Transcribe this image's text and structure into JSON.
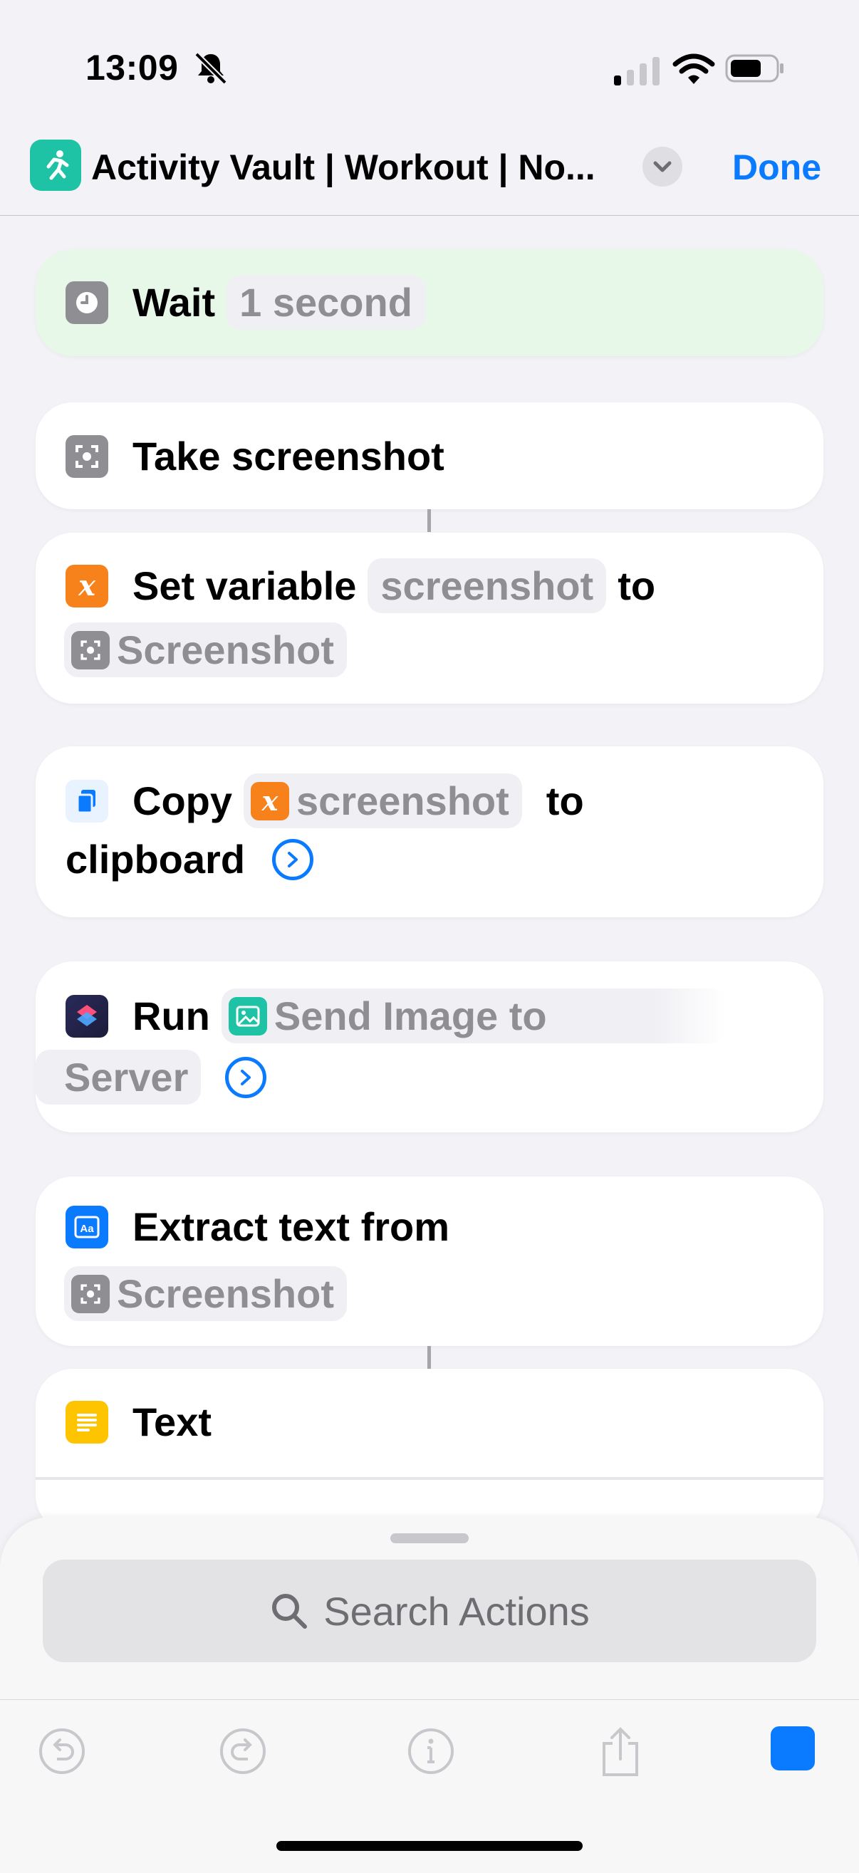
{
  "status_bar": {
    "time": "13:09"
  },
  "nav": {
    "title": "Activity Vault | Workout | No...",
    "done_label": "Done"
  },
  "actions": {
    "wait": {
      "verb": "Wait",
      "value": "1 second"
    },
    "take_screenshot": {
      "label": "Take screenshot"
    },
    "set_variable": {
      "verb": "Set variable",
      "variable": "screenshot",
      "to": "to",
      "value": "Screenshot"
    },
    "copy": {
      "verb": "Copy",
      "variable": "screenshot",
      "to": "to",
      "rest": "clipboard"
    },
    "run": {
      "verb": "Run",
      "shortcut_part1": "Send Image to",
      "shortcut_part2": "Server"
    },
    "extract": {
      "verb": "Extract text from",
      "value": "Screenshot"
    },
    "text": {
      "label": "Text"
    }
  },
  "sheet": {
    "search_placeholder": "Search Actions"
  },
  "colors": {
    "accent": "#0a7aff",
    "variable_orange": "#f7821b",
    "app_teal": "#1ec3a6",
    "wait_bg": "#e7f8e9"
  }
}
